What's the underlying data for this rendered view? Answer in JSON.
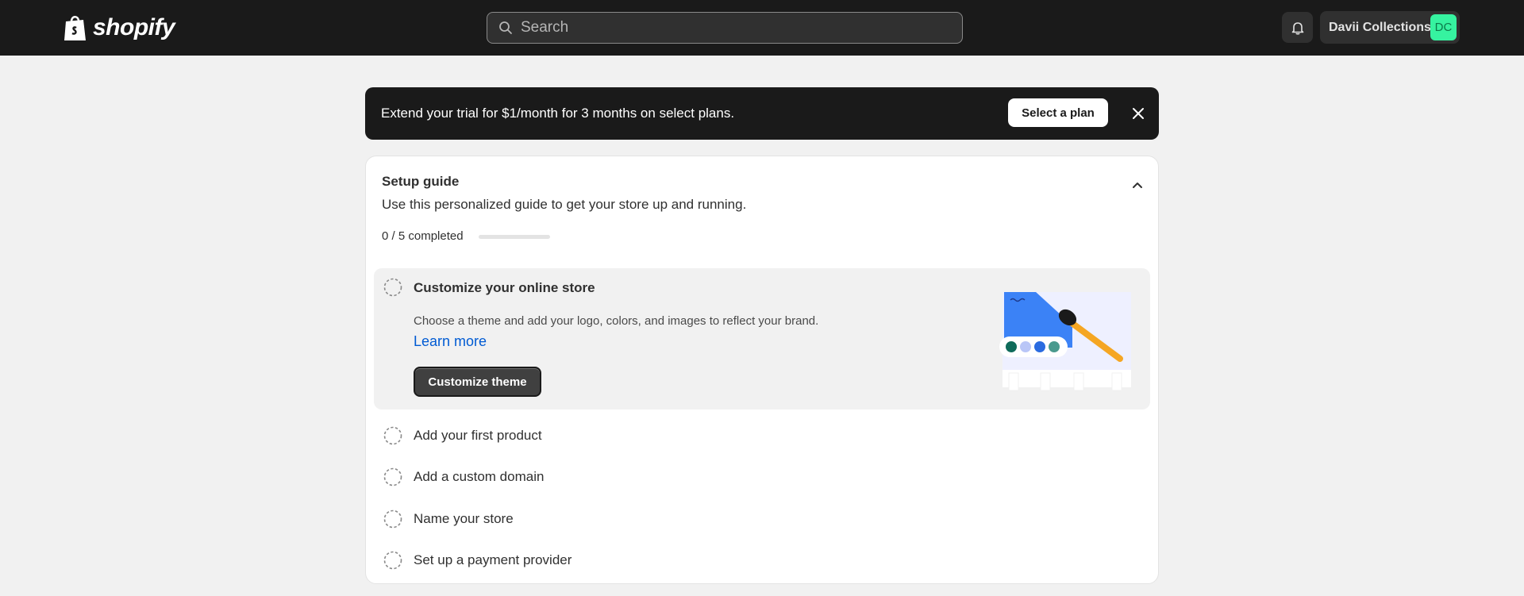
{
  "topbar": {
    "logo_text": "shopify",
    "search_placeholder": "Search",
    "store_name": "Davii Collections",
    "avatar_initials": "DC"
  },
  "banner": {
    "text": "Extend your trial for $1/month for 3 months on select plans.",
    "button_label": "Select a plan"
  },
  "setup_guide": {
    "title": "Setup guide",
    "subtitle": "Use this personalized guide to get your store up and running.",
    "progress_text": "0 / 5 completed",
    "progress_fraction": 0,
    "active_task": {
      "title": "Customize your online store",
      "description": "Choose a theme and add your logo, colors, and images to reflect your brand.",
      "link": "Learn more",
      "button": "Customize theme"
    },
    "tasks": [
      {
        "title": "Add your first product"
      },
      {
        "title": "Add a custom domain"
      },
      {
        "title": "Name your store"
      },
      {
        "title": "Set up a payment provider"
      }
    ]
  },
  "colors": {
    "topbar": "#1a1a1a",
    "avatar": "#36f3a0",
    "link": "#005bd3",
    "swatches": [
      "#0f6b5a",
      "#b9c6f7",
      "#2a6be0",
      "#4a9a8e"
    ]
  }
}
